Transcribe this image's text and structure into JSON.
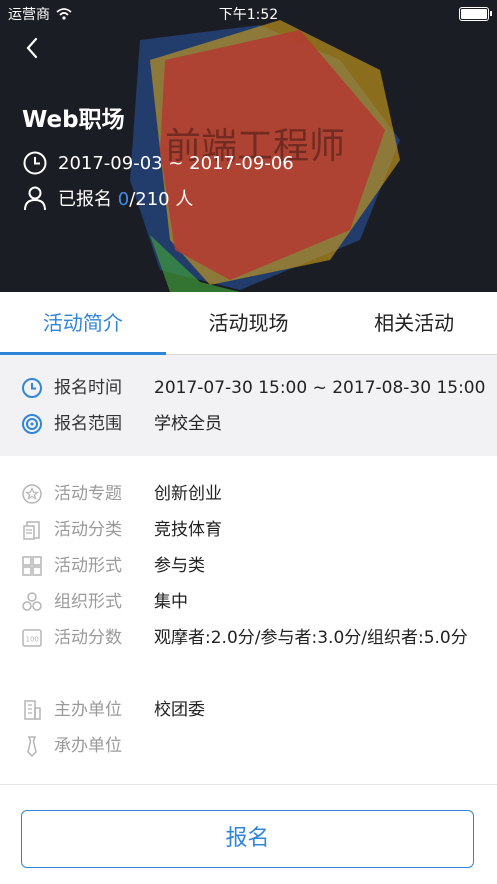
{
  "status_bar": {
    "carrier": "运营商",
    "time": "下午1:52"
  },
  "hero": {
    "banner_text": "前端工程师",
    "title": "Web职场",
    "date_range": "2017-09-03 ~ 2017-09-06",
    "signup_prefix": "已报名 ",
    "signup_count": "0",
    "signup_total": "/210 人"
  },
  "tabs": [
    {
      "label": "活动简介",
      "active": true
    },
    {
      "label": "活动现场",
      "active": false
    },
    {
      "label": "相关活动",
      "active": false
    }
  ],
  "registration": {
    "time_label": "报名时间",
    "time_value": "2017-07-30 15:00 ~ 2017-08-30 15:00",
    "scope_label": "报名范围",
    "scope_value": "学校全员"
  },
  "details": {
    "topic_label": "活动专题",
    "topic_value": "创新创业",
    "category_label": "活动分类",
    "category_value": "竞技体育",
    "format_label": "活动形式",
    "format_value": "参与类",
    "org_label": "组织形式",
    "org_value": "集中",
    "score_label": "活动分数",
    "score_value": "观摩者:2.0分/参与者:3.0分/组织者:5.0分",
    "host_label": "主办单位",
    "host_value": "校团委",
    "co_label": "承办单位",
    "co_value": ""
  },
  "footer": {
    "button_label": "报名"
  },
  "colors": {
    "accent": "#2f86d9",
    "hero_bg": "#1b1d24"
  }
}
